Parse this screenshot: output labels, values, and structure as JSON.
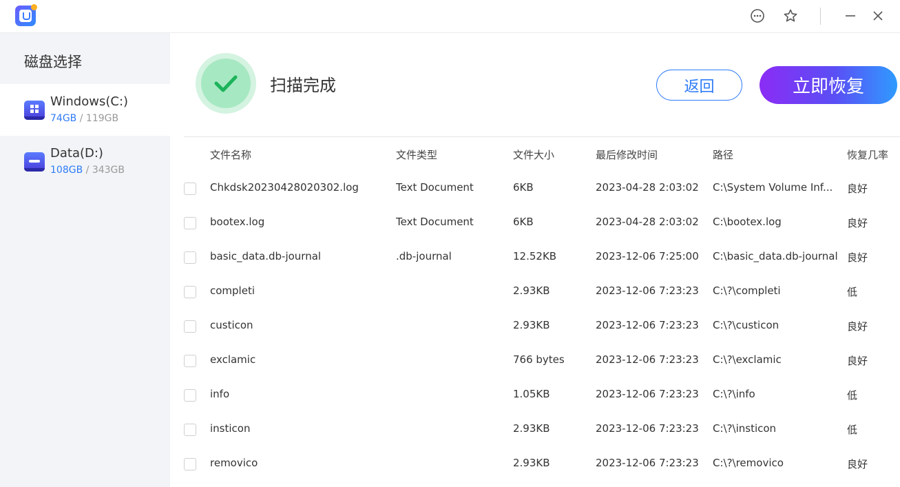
{
  "window": {
    "icons": {
      "logo": "app-logo-icon",
      "feedback": "chat-bubble-icon",
      "favorite": "star-icon",
      "minimize": "minimize-icon",
      "close": "close-icon"
    }
  },
  "sidebar": {
    "title": "磁盘选择",
    "drives": [
      {
        "name": "Windows(C:)",
        "used": "74GB",
        "sep": " / ",
        "total": "119GB",
        "icon": "windows-drive-icon"
      },
      {
        "name": "Data(D:)",
        "used": "108GB",
        "sep": " / ",
        "total": "343GB",
        "icon": "hard-drive-icon"
      }
    ]
  },
  "status": {
    "text": "扫描完成",
    "icon": "checkmark-icon",
    "colors": {
      "outer": "#d4f3e1",
      "inner": "#a6e8c2",
      "check": "#1cb35a"
    }
  },
  "actions": {
    "back_label": "返回",
    "recover_label": "立即恢复",
    "accent": "#2e7bf6"
  },
  "table": {
    "headers": {
      "name": "文件名称",
      "type": "文件类型",
      "size": "文件大小",
      "modified": "最后修改时间",
      "path": "路径",
      "recoverability": "恢复几率"
    },
    "rows": [
      {
        "name": "Chkdsk20230428020302.log",
        "type": "Text Document",
        "size": "6KB",
        "modified": "2023-04-28 2:03:02",
        "path": "C:\\System Volume Inf...",
        "recoverability": "良好"
      },
      {
        "name": "bootex.log",
        "type": "Text Document",
        "size": "6KB",
        "modified": "2023-04-28 2:03:02",
        "path": "C:\\bootex.log",
        "recoverability": "良好"
      },
      {
        "name": "basic_data.db-journal",
        "type": ".db-journal",
        "size": "12.52KB",
        "modified": "2023-12-06 7:25:00",
        "path": "C:\\basic_data.db-journal",
        "recoverability": "良好"
      },
      {
        "name": "completi",
        "type": "",
        "size": "2.93KB",
        "modified": "2023-12-06 7:23:23",
        "path": "C:\\?\\completi",
        "recoverability": "低"
      },
      {
        "name": "custicon",
        "type": "",
        "size": "2.93KB",
        "modified": "2023-12-06 7:23:23",
        "path": "C:\\?\\custicon",
        "recoverability": "良好"
      },
      {
        "name": "exclamic",
        "type": "",
        "size": "766 bytes",
        "modified": "2023-12-06 7:23:23",
        "path": "C:\\?\\exclamic",
        "recoverability": "良好"
      },
      {
        "name": "info",
        "type": "",
        "size": "1.05KB",
        "modified": "2023-12-06 7:23:23",
        "path": "C:\\?\\info",
        "recoverability": "低"
      },
      {
        "name": "insticon",
        "type": "",
        "size": "2.93KB",
        "modified": "2023-12-06 7:23:23",
        "path": "C:\\?\\insticon",
        "recoverability": "低"
      },
      {
        "name": "removico",
        "type": "",
        "size": "2.93KB",
        "modified": "2023-12-06 7:23:23",
        "path": "C:\\?\\removico",
        "recoverability": "良好"
      }
    ]
  }
}
